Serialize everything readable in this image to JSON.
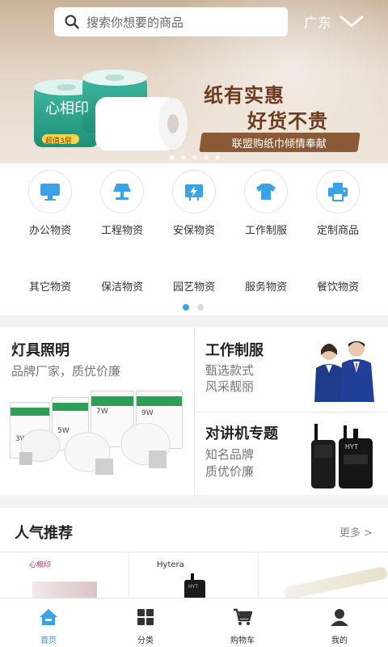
{
  "header": {
    "search_placeholder": "搜索你想要的商品",
    "region": "广东"
  },
  "banner": {
    "brand_text": "心相印",
    "pack_badge": "超值3层",
    "slogan_line1": "纸有实惠",
    "slogan_line2": "好货不贵",
    "ribbon": "联盟购纸巾倾情奉献",
    "slide_count": 5,
    "active_slide": 1
  },
  "categories": {
    "row1": [
      {
        "label": "办公物资",
        "icon": "monitor-icon"
      },
      {
        "label": "工程物资",
        "icon": "lamp-icon"
      },
      {
        "label": "安保物资",
        "icon": "power-icon"
      },
      {
        "label": "工作制服",
        "icon": "shirt-icon"
      },
      {
        "label": "定制商品",
        "icon": "printer-icon"
      }
    ],
    "row2": [
      {
        "label": "其它物资"
      },
      {
        "label": "保洁物资"
      },
      {
        "label": "园艺物资"
      },
      {
        "label": "服务物资"
      },
      {
        "label": "餐饮物资"
      }
    ],
    "page_count": 2,
    "active_page": 1
  },
  "promo": {
    "lighting": {
      "title": "灯具照明",
      "subtitle": "品牌厂家，质优价廉",
      "boxes": [
        "LED球泡灯 3W",
        "LED球泡灯 5W",
        "LED球泡灯 7W",
        "LED球泡灯 9W"
      ],
      "box_labels": [
        "LED球泡灯",
        "LED球泡灯",
        "LED球泡灯",
        "LED球泡灯"
      ],
      "wattages": [
        "3W",
        "5W",
        "7W",
        "9W"
      ]
    },
    "uniform": {
      "title": "工作制服",
      "subtitle1": "甄选款式",
      "subtitle2": "风采靓丽"
    },
    "radio": {
      "title": "对讲机专题",
      "subtitle1": "知名品牌",
      "subtitle2": "质优价廉",
      "brand": "HYT"
    }
  },
  "recommend": {
    "title": "人气推荐",
    "more": "更多 >",
    "items": [
      {
        "brand": "心相印"
      },
      {
        "brand": "Hytera",
        "model": "HYT"
      },
      {
        "brand": ""
      }
    ]
  },
  "tabbar": [
    {
      "label": "首页",
      "icon": "home-icon",
      "active": true
    },
    {
      "label": "分类",
      "icon": "grid-icon",
      "active": false
    },
    {
      "label": "购物车",
      "icon": "cart-icon",
      "active": false
    },
    {
      "label": "我的",
      "icon": "user-icon",
      "active": false
    }
  ],
  "colors": {
    "accent": "#2f8fe0",
    "icon_blue": "#3aa3e8",
    "ribbon": "#8a5a36"
  }
}
